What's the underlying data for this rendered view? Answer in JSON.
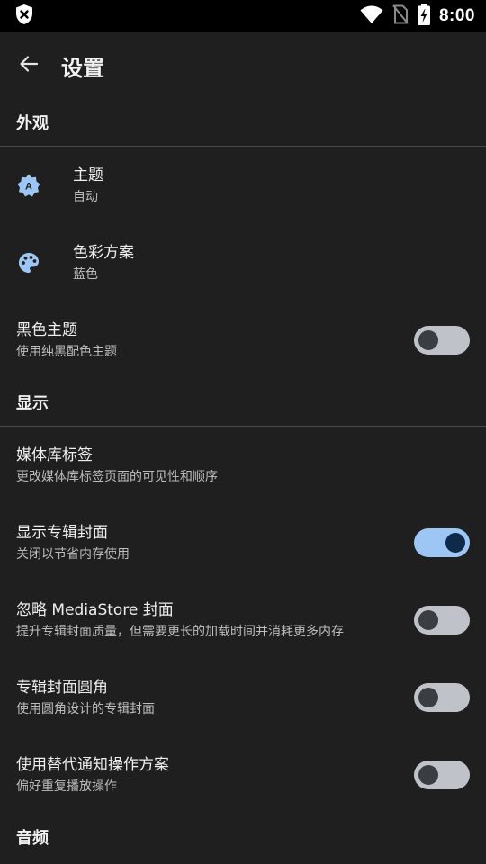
{
  "status_bar": {
    "time": "8:00",
    "icons": [
      "shield-x-icon",
      "wifi-icon",
      "no-sim-icon",
      "battery-charging-icon"
    ]
  },
  "app_bar": {
    "back_icon": "arrow-left-icon",
    "title": "设置"
  },
  "sections": {
    "appearance": {
      "header": "外观",
      "theme": {
        "title": "主题",
        "summary": "自动",
        "icon": "theme-brightness-icon"
      },
      "color_scheme": {
        "title": "色彩方案",
        "summary": "蓝色",
        "icon": "palette-icon"
      },
      "black_theme": {
        "title": "黑色主题",
        "summary": "使用纯黑配色主题",
        "enabled": false
      }
    },
    "display": {
      "header": "显示",
      "library_tabs": {
        "title": "媒体库标签",
        "summary": "更改媒体库标签页面的可见性和顺序"
      },
      "show_album_art": {
        "title": "显示专辑封面",
        "summary": "关闭以节省内存使用",
        "enabled": true
      },
      "ignore_mediastore": {
        "title": "忽略 MediaStore 封面",
        "summary": "提升专辑封面质量，但需要更长的加载时间并消耗更多内存",
        "enabled": false
      },
      "round_covers": {
        "title": "专辑封面圆角",
        "summary": "使用圆角设计的专辑封面",
        "enabled": false
      },
      "alt_notification": {
        "title": "使用替代通知操作方案",
        "summary": "偏好重复播放操作",
        "enabled": false
      }
    },
    "audio": {
      "header": "音频"
    }
  },
  "colors": {
    "background": "#1f1f1f",
    "accent": "#9dc6f5",
    "accent_dark": "#0d2a4a",
    "switch_off_track": "#bfc3c9"
  }
}
